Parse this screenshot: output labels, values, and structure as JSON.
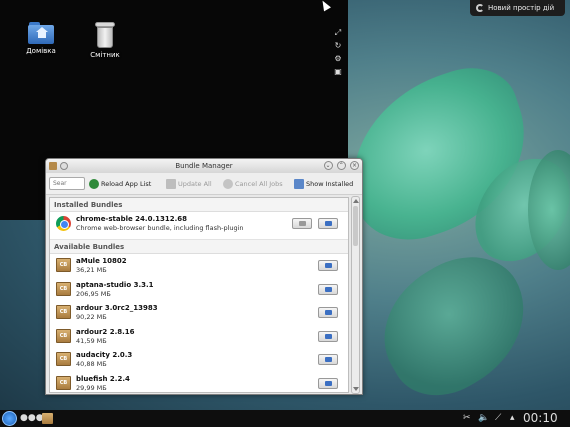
{
  "desktop": {
    "icons": [
      {
        "label": "Домівка",
        "icon": "home-folder-icon"
      },
      {
        "label": "Смітник",
        "icon": "trash-icon"
      }
    ],
    "activity_button": "Новий простір дій"
  },
  "window": {
    "title": "Bundle Manager",
    "toolbar": {
      "search_placeholder": "Sear",
      "reload": "Reload App List",
      "update_all": "Update All",
      "cancel_all": "Cancel All Jobs",
      "show_installed": "Show Installed"
    },
    "installed_header": "Installed Bundles",
    "installed": [
      {
        "name": "chrome-stable 24.0.1312.68",
        "desc": "Chrome web-browser bundle, including flash-plugin"
      }
    ],
    "available_header": "Available Bundles",
    "available": [
      {
        "name": "aMule 10802",
        "size": "36,21 МБ"
      },
      {
        "name": "aptana-studio 3.3.1",
        "size": "206,95 МБ"
      },
      {
        "name": "ardour 3.0rc2_13983",
        "size": "90,22 МБ"
      },
      {
        "name": "ardour2 2.8.16",
        "size": "41,59 МБ"
      },
      {
        "name": "audacity 2.0.3",
        "size": "40,88 МБ"
      },
      {
        "name": "bluefish 2.2.4",
        "size": "29,99 МБ"
      }
    ],
    "package_badge": "CB"
  },
  "taskbar": {
    "clock": "00:10"
  }
}
